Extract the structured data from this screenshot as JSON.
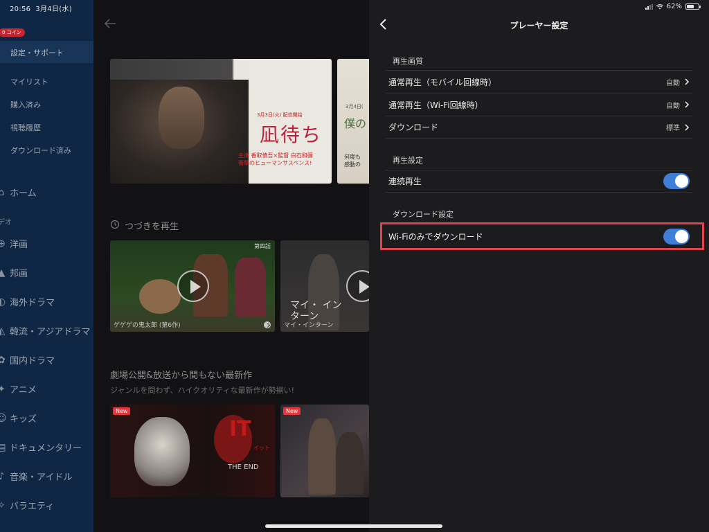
{
  "status_bar": {
    "time": "20:56",
    "date": "3月4日(水)",
    "battery": "62%"
  },
  "sidebar": {
    "coin_badge": "0 コイン",
    "active_item": "設定・サポート",
    "sub_items": [
      {
        "label": "マイリスト"
      },
      {
        "label": "購入済み"
      },
      {
        "label": "視聴履歴"
      },
      {
        "label": "ダウンロード済み"
      }
    ],
    "home": "ホーム",
    "section": "デオ",
    "genres": [
      {
        "label": "洋画",
        "icon": "globe-icon"
      },
      {
        "label": "邦画",
        "icon": "mountain-icon"
      },
      {
        "label": "海外ドラマ",
        "icon": "drama-icon"
      },
      {
        "label": "韓流・アジアドラマ",
        "icon": "fan-icon"
      },
      {
        "label": "国内ドラマ",
        "icon": "flower-icon"
      },
      {
        "label": "アニメ",
        "icon": "star-icon"
      },
      {
        "label": "キッズ",
        "icon": "kids-icon"
      },
      {
        "label": "ドキュメンタリー",
        "icon": "document-icon"
      },
      {
        "label": "音楽・アイドル",
        "icon": "music-icon"
      },
      {
        "label": "バラエティ",
        "icon": "variety-icon"
      }
    ]
  },
  "main": {
    "hero": {
      "date": "3月3日(火) 配信開始",
      "title": "凪待ち",
      "cast_line1": "主演 香取慎吾×監督 白石和彌",
      "cast_line2": "衝撃のヒューマンサスペンス!"
    },
    "hero2": {
      "date": "3月4日(",
      "title": "僕の",
      "desc_line1": "何度も",
      "desc_line2": "感動の"
    },
    "continue": {
      "title": "つづきを再生",
      "cards": [
        {
          "caption": "ゲゲゲの鬼太郎 (第6作)",
          "episode": "第四話"
        },
        {
          "caption": "マイ・インターン",
          "overlay": "マイ・ インターン"
        }
      ]
    },
    "latest": {
      "title": "劇場公開&放送から間もない最新作",
      "subtitle": "ジャンルを問わず、ハイクオリティな最新作が勢揃い!",
      "new_label": "New",
      "movie_title": "IT",
      "movie_sub": "THE END",
      "movie_tag": "イット"
    }
  },
  "panel": {
    "title": "プレーヤー設定",
    "quality_label": "再生画質",
    "quality_rows": [
      {
        "label": "通常再生（モバイル回線時）",
        "value": "自動"
      },
      {
        "label": "通常再生（Wi-Fi回線時）",
        "value": "自動"
      },
      {
        "label": "ダウンロード",
        "value": "標準"
      }
    ],
    "playback_label": "再生設定",
    "autoplay": {
      "label": "連続再生",
      "on": true
    },
    "download_label": "ダウンロード設定",
    "wifi_only": {
      "label": "Wi-Fiのみでダウンロード",
      "on": true
    }
  }
}
